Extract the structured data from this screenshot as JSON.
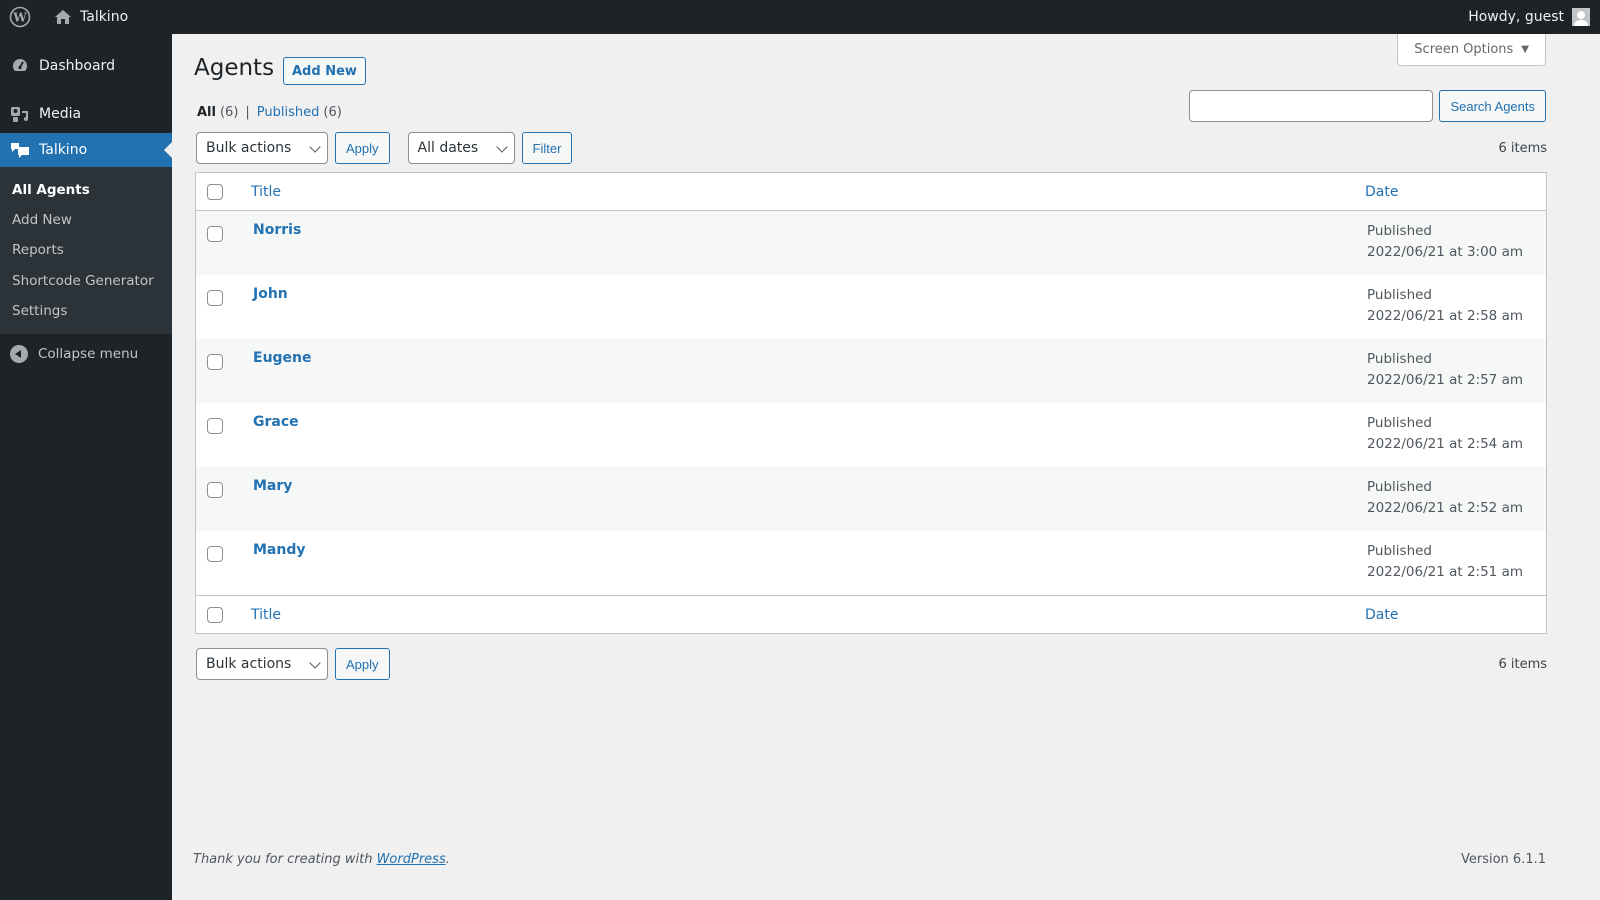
{
  "adminbar": {
    "site_name": "Talkino",
    "howdy": "Howdy, guest"
  },
  "sidebar": {
    "items": [
      {
        "label": "Dashboard",
        "icon": "dashboard-icon"
      },
      {
        "label": "Media",
        "icon": "media-icon"
      },
      {
        "label": "Talkino",
        "icon": "chat-bubbles-icon",
        "current": true
      }
    ],
    "submenu": [
      {
        "label": "All Agents",
        "active": true
      },
      {
        "label": "Add New"
      },
      {
        "label": "Reports"
      },
      {
        "label": "Shortcode Generator"
      },
      {
        "label": "Settings"
      }
    ],
    "collapse_label": "Collapse menu"
  },
  "header": {
    "screen_options": "Screen Options",
    "title": "Agents",
    "add_new": "Add New"
  },
  "views": {
    "all_label": "All",
    "all_count": "(6)",
    "separator": "|",
    "published_label": "Published",
    "published_count": "(6)"
  },
  "search": {
    "value": "",
    "button": "Search Agents"
  },
  "tablenav": {
    "bulk_actions": "Bulk actions",
    "apply": "Apply",
    "all_dates": "All dates",
    "filter": "Filter",
    "items_count": "6 items"
  },
  "table": {
    "columns": {
      "title": "Title",
      "date": "Date"
    },
    "rows": [
      {
        "title": "Norris",
        "status": "Published",
        "date": "2022/06/21 at 3:00 am"
      },
      {
        "title": "John",
        "status": "Published",
        "date": "2022/06/21 at 2:58 am"
      },
      {
        "title": "Eugene",
        "status": "Published",
        "date": "2022/06/21 at 2:57 am"
      },
      {
        "title": "Grace",
        "status": "Published",
        "date": "2022/06/21 at 2:54 am"
      },
      {
        "title": "Mary",
        "status": "Published",
        "date": "2022/06/21 at 2:52 am"
      },
      {
        "title": "Mandy",
        "status": "Published",
        "date": "2022/06/21 at 2:51 am"
      }
    ]
  },
  "footer": {
    "thanks_prefix": "Thank you for creating with ",
    "thanks_link": "WordPress",
    "thanks_suffix": ".",
    "version": "Version 6.1.1"
  },
  "colors": {
    "accent": "#2271b1",
    "sidebar_bg": "#1d2327",
    "submenu_bg": "#2c3338",
    "page_bg": "#f0f0f1"
  }
}
